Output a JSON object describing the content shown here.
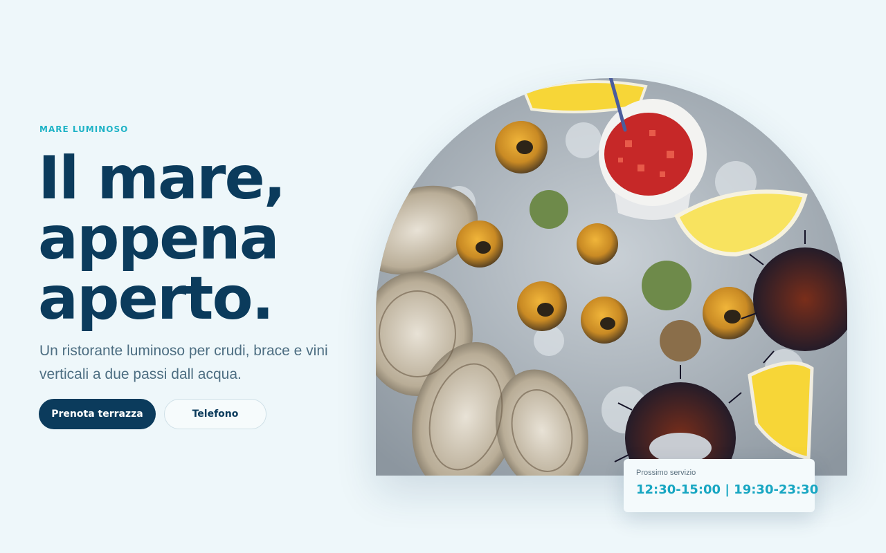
{
  "hero": {
    "eyebrow": "MARE LUMINOSO",
    "headline": [
      "Il mare,",
      "appena",
      "aperto."
    ],
    "subtitle": "Un ristorante luminoso per crudi, brace e vini verticali a due passi dall acqua.",
    "primary_button": "Prenota terrazza",
    "secondary_button": "Telefono"
  },
  "image": {
    "alt": "Seafood platter with oysters, sea snails, sea urchins, lemon wedges and a chili sauce on ice"
  },
  "service": {
    "label": "Prossimo servizio",
    "hours": "12:30-15:00 | 19:30-23:30"
  },
  "colors": {
    "background": "#eef7fa",
    "navy": "#0b3b5c",
    "accent": "#1fb3c6",
    "text_muted": "#4d6e82"
  }
}
